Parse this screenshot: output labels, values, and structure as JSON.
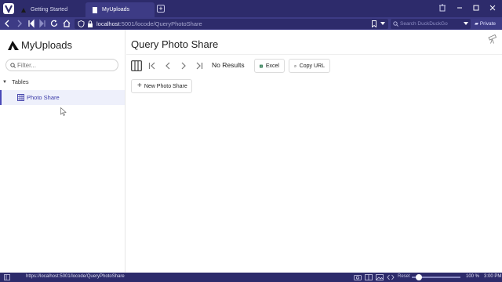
{
  "browser": {
    "tabs": [
      {
        "label": "Getting Started"
      },
      {
        "label": "MyUploads"
      }
    ],
    "address": {
      "host": "localhost",
      "path": ":5001/locode/QueryPhotoShare"
    },
    "search_placeholder": "Search DuckDuckGo",
    "private_label": "Private",
    "status_url": "https://localhost:5001/locode/QueryPhotoShare",
    "reset_label": "Reset",
    "zoom_label": "100 %",
    "zoom_fraction": 0.14,
    "clock": "3:00 PM"
  },
  "sidebar": {
    "brand": "MyUploads",
    "filter_placeholder": "Filter...",
    "section": "Tables",
    "items": [
      {
        "label": "Photo Share"
      }
    ]
  },
  "main": {
    "title": "Query Photo Share",
    "results_text": "No Results",
    "excel_label": "Excel",
    "copy_url_label": "Copy URL",
    "new_label": "New Photo Share"
  },
  "colors": {
    "chrome_dark": "#2d2b6b",
    "chrome": "#3d3b85",
    "accent": "#4a49b8",
    "excel_green": "#1e7145"
  },
  "icons": [
    "vivaldi-logo-icon",
    "globe-icon",
    "page-icon",
    "back-icon",
    "forward-icon",
    "home-icon",
    "reload-icon",
    "shield-icon",
    "bookmark-icon",
    "search-icon",
    "columns-icon",
    "first-page-icon",
    "prev-page-icon",
    "next-page-icon",
    "last-page-icon",
    "excel-icon",
    "copy-icon",
    "plus-icon",
    "telescope-icon",
    "grid-icon"
  ]
}
